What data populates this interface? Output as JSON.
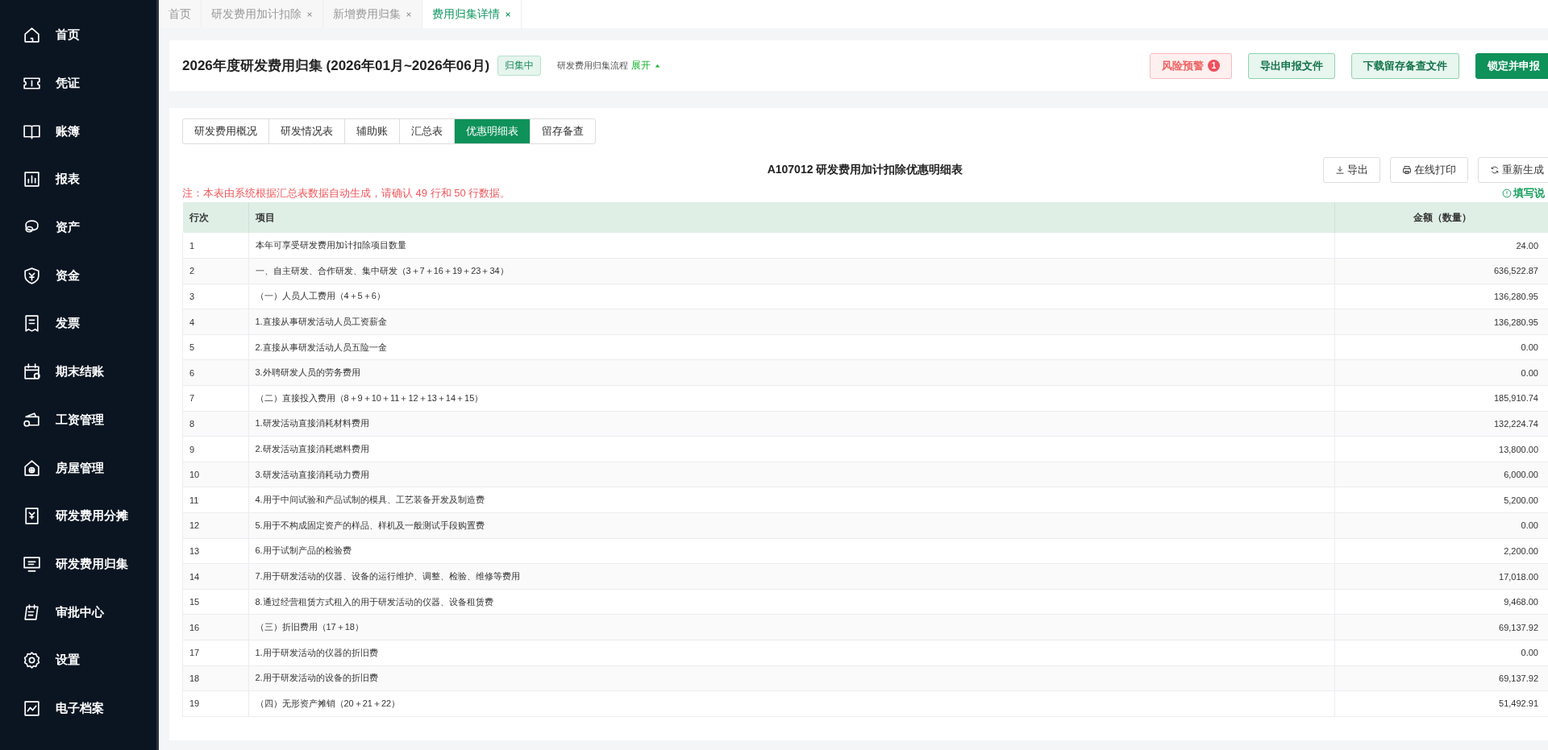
{
  "sidebar": {
    "items": [
      {
        "label": "首页",
        "selected": false
      },
      {
        "label": "凭证",
        "selected": false
      },
      {
        "label": "账簿",
        "selected": false
      },
      {
        "label": "报表",
        "selected": false
      },
      {
        "label": "资产",
        "selected": false
      },
      {
        "label": "资金",
        "selected": false
      },
      {
        "label": "发票",
        "selected": false
      },
      {
        "label": "期末结账",
        "selected": false
      },
      {
        "label": "工资管理",
        "selected": false
      },
      {
        "label": "房屋管理",
        "selected": false
      },
      {
        "label": "研发费用分摊",
        "selected": false
      },
      {
        "label": "研发费用归集",
        "selected": false
      },
      {
        "label": "审批中心",
        "selected": false
      },
      {
        "label": "设置",
        "selected": false
      },
      {
        "label": "电子档案",
        "selected": false
      }
    ]
  },
  "page_tabs": [
    {
      "label": "首页",
      "closable": false,
      "selected": false
    },
    {
      "label": "研发费用加计扣除",
      "closable": true,
      "selected": false
    },
    {
      "label": "新增费用归集",
      "closable": true,
      "selected": false
    },
    {
      "label": "费用归集详情",
      "closable": true,
      "selected": true
    }
  ],
  "header": {
    "title": "2026年度研发费用归集 (2026年01月~2026年06月)",
    "status": "归集中",
    "flow_label": "研发费用归集流程",
    "flow_toggle": "展开",
    "buttons": [
      {
        "label": "风险预警",
        "kind": "danger",
        "badge": "1"
      },
      {
        "label": "导出申报文件",
        "kind": "light"
      },
      {
        "label": "下载留存备查文件",
        "kind": "light"
      },
      {
        "label": "锁定并申报",
        "kind": "primary"
      }
    ]
  },
  "sub_tabs": [
    {
      "label": "研发费用概况",
      "selected": false
    },
    {
      "label": "研发情况表",
      "selected": false
    },
    {
      "label": "辅助账",
      "selected": false
    },
    {
      "label": "汇总表",
      "selected": false
    },
    {
      "label": "优惠明细表",
      "selected": true
    },
    {
      "label": "留存备查",
      "selected": false
    }
  ],
  "report": {
    "title": "A107012 研发费用加计扣除优惠明细表",
    "tools": [
      {
        "label": "导出",
        "kind": "export"
      },
      {
        "label": "在线打印",
        "kind": "print"
      },
      {
        "label": "重新生成",
        "kind": "refresh"
      }
    ],
    "note": "注：本表由系统根据汇总表数据自动生成，请确认 49 行和 50 行数据。",
    "help_link": "填写说",
    "table": {
      "columns": [
        "行次",
        "项目",
        "金额（数量）"
      ],
      "rows": [
        [
          "1",
          "本年可享受研发费用加计扣除项目数量",
          "24.00"
        ],
        [
          "2",
          "一、自主研发、合作研发、集中研发（3＋7＋16＋19＋23＋34）",
          "636,522.87"
        ],
        [
          "3",
          "（一）人员人工费用（4＋5＋6）",
          "136,280.95"
        ],
        [
          "4",
          "1.直接从事研发活动人员工资薪金",
          "136,280.95"
        ],
        [
          "5",
          "2.直接从事研发活动人员五险一金",
          "0.00"
        ],
        [
          "6",
          "3.外聘研发人员的劳务费用",
          "0.00"
        ],
        [
          "7",
          "（二）直接投入费用（8＋9＋10＋11＋12＋13＋14＋15）",
          "185,910.74"
        ],
        [
          "8",
          "1.研发活动直接消耗材料费用",
          "132,224.74"
        ],
        [
          "9",
          "2.研发活动直接消耗燃料费用",
          "13,800.00"
        ],
        [
          "10",
          "3.研发活动直接消耗动力费用",
          "6,000.00"
        ],
        [
          "11",
          "4.用于中间试验和产品试制的模具、工艺装备开发及制造费",
          "5,200.00"
        ],
        [
          "12",
          "5.用于不构成固定资产的样品、样机及一般测试手段购置费",
          "0.00"
        ],
        [
          "13",
          "6.用于试制产品的检验费",
          "2,200.00"
        ],
        [
          "14",
          "7.用于研发活动的仪器、设备的运行维护、调整、检验、维修等费用",
          "17,018.00"
        ],
        [
          "15",
          "8.通过经营租赁方式租入的用于研发活动的仪器、设备租赁费",
          "9,468.00"
        ],
        [
          "16",
          "（三）折旧费用（17＋18）",
          "69,137.92"
        ],
        [
          "17",
          "1.用于研发活动的仪器的折旧费",
          "0.00"
        ],
        [
          "18",
          "2.用于研发活动的设备的折旧费",
          "69,137.92"
        ],
        [
          "19",
          "（四）无形资产摊销（20＋21＋22）",
          "51,492.91"
        ]
      ]
    }
  }
}
